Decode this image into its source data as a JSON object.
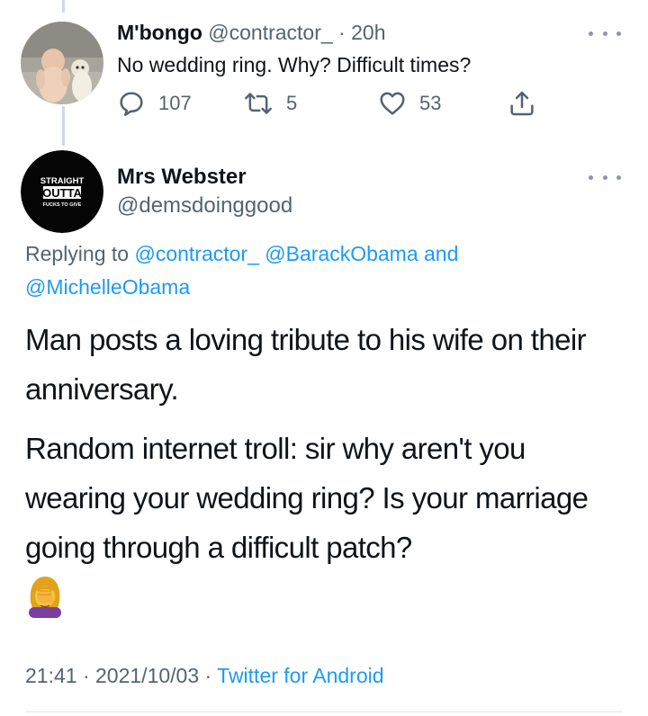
{
  "reply_tweet": {
    "display_name": "M'bongo",
    "handle": "@contractor_",
    "separator": " · ",
    "time_ago": "20h",
    "text": "No wedding ring. Why? Difficult times?",
    "actions": {
      "reply_count": "107",
      "retweet_count": "5",
      "like_count": "53"
    }
  },
  "main_tweet": {
    "display_name": "Mrs Webster",
    "handle": "@demsdoinggood",
    "avatar_text": {
      "line1": "STRAIGHT",
      "line2": "OUTTA",
      "line3": "FUCKS TO GIVE"
    },
    "replying_to": {
      "prefix": "Replying to ",
      "mention1": "@contractor_",
      "mention2": "@BarackObama",
      "conjunction": " and",
      "mention3": "@MichelleObama"
    },
    "paragraph1": "Man posts a loving tribute to his wife on their anniversary.",
    "paragraph2": "Random internet troll: sir why aren't you wearing your wedding ring? Is your marriage going through a difficult patch?",
    "emoji": "woman-facepalming",
    "time": "21:41",
    "date": "2021/10/03",
    "source": "Twitter for Android",
    "dot": " · "
  },
  "colors": {
    "link": "#1d9bf0",
    "muted": "#536471",
    "text": "#0f1419"
  }
}
